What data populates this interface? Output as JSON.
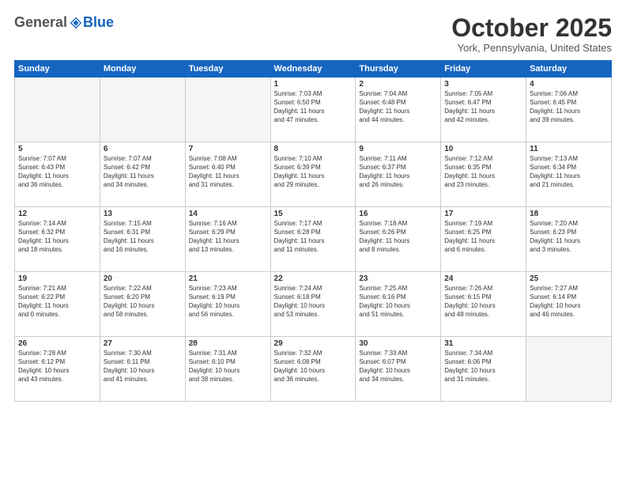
{
  "header": {
    "logo": {
      "general": "General",
      "blue": "Blue"
    },
    "title": "October 2025",
    "location": "York, Pennsylvania, United States"
  },
  "weekdays": [
    "Sunday",
    "Monday",
    "Tuesday",
    "Wednesday",
    "Thursday",
    "Friday",
    "Saturday"
  ],
  "weeks": [
    [
      {
        "day": "",
        "info": ""
      },
      {
        "day": "",
        "info": ""
      },
      {
        "day": "",
        "info": ""
      },
      {
        "day": "1",
        "info": "Sunrise: 7:03 AM\nSunset: 6:50 PM\nDaylight: 11 hours\nand 47 minutes."
      },
      {
        "day": "2",
        "info": "Sunrise: 7:04 AM\nSunset: 6:48 PM\nDaylight: 11 hours\nand 44 minutes."
      },
      {
        "day": "3",
        "info": "Sunrise: 7:05 AM\nSunset: 6:47 PM\nDaylight: 11 hours\nand 42 minutes."
      },
      {
        "day": "4",
        "info": "Sunrise: 7:06 AM\nSunset: 6:45 PM\nDaylight: 11 hours\nand 39 minutes."
      }
    ],
    [
      {
        "day": "5",
        "info": "Sunrise: 7:07 AM\nSunset: 6:43 PM\nDaylight: 11 hours\nand 36 minutes."
      },
      {
        "day": "6",
        "info": "Sunrise: 7:07 AM\nSunset: 6:42 PM\nDaylight: 11 hours\nand 34 minutes."
      },
      {
        "day": "7",
        "info": "Sunrise: 7:08 AM\nSunset: 6:40 PM\nDaylight: 11 hours\nand 31 minutes."
      },
      {
        "day": "8",
        "info": "Sunrise: 7:10 AM\nSunset: 6:39 PM\nDaylight: 11 hours\nand 29 minutes."
      },
      {
        "day": "9",
        "info": "Sunrise: 7:11 AM\nSunset: 6:37 PM\nDaylight: 11 hours\nand 26 minutes."
      },
      {
        "day": "10",
        "info": "Sunrise: 7:12 AM\nSunset: 6:35 PM\nDaylight: 11 hours\nand 23 minutes."
      },
      {
        "day": "11",
        "info": "Sunrise: 7:13 AM\nSunset: 6:34 PM\nDaylight: 11 hours\nand 21 minutes."
      }
    ],
    [
      {
        "day": "12",
        "info": "Sunrise: 7:14 AM\nSunset: 6:32 PM\nDaylight: 11 hours\nand 18 minutes."
      },
      {
        "day": "13",
        "info": "Sunrise: 7:15 AM\nSunset: 6:31 PM\nDaylight: 11 hours\nand 16 minutes."
      },
      {
        "day": "14",
        "info": "Sunrise: 7:16 AM\nSunset: 6:29 PM\nDaylight: 11 hours\nand 13 minutes."
      },
      {
        "day": "15",
        "info": "Sunrise: 7:17 AM\nSunset: 6:28 PM\nDaylight: 11 hours\nand 11 minutes."
      },
      {
        "day": "16",
        "info": "Sunrise: 7:18 AM\nSunset: 6:26 PM\nDaylight: 11 hours\nand 8 minutes."
      },
      {
        "day": "17",
        "info": "Sunrise: 7:19 AM\nSunset: 6:25 PM\nDaylight: 11 hours\nand 6 minutes."
      },
      {
        "day": "18",
        "info": "Sunrise: 7:20 AM\nSunset: 6:23 PM\nDaylight: 11 hours\nand 3 minutes."
      }
    ],
    [
      {
        "day": "19",
        "info": "Sunrise: 7:21 AM\nSunset: 6:22 PM\nDaylight: 11 hours\nand 0 minutes."
      },
      {
        "day": "20",
        "info": "Sunrise: 7:22 AM\nSunset: 6:20 PM\nDaylight: 10 hours\nand 58 minutes."
      },
      {
        "day": "21",
        "info": "Sunrise: 7:23 AM\nSunset: 6:19 PM\nDaylight: 10 hours\nand 56 minutes."
      },
      {
        "day": "22",
        "info": "Sunrise: 7:24 AM\nSunset: 6:18 PM\nDaylight: 10 hours\nand 53 minutes."
      },
      {
        "day": "23",
        "info": "Sunrise: 7:25 AM\nSunset: 6:16 PM\nDaylight: 10 hours\nand 51 minutes."
      },
      {
        "day": "24",
        "info": "Sunrise: 7:26 AM\nSunset: 6:15 PM\nDaylight: 10 hours\nand 48 minutes."
      },
      {
        "day": "25",
        "info": "Sunrise: 7:27 AM\nSunset: 6:14 PM\nDaylight: 10 hours\nand 46 minutes."
      }
    ],
    [
      {
        "day": "26",
        "info": "Sunrise: 7:28 AM\nSunset: 6:12 PM\nDaylight: 10 hours\nand 43 minutes."
      },
      {
        "day": "27",
        "info": "Sunrise: 7:30 AM\nSunset: 6:11 PM\nDaylight: 10 hours\nand 41 minutes."
      },
      {
        "day": "28",
        "info": "Sunrise: 7:31 AM\nSunset: 6:10 PM\nDaylight: 10 hours\nand 38 minutes."
      },
      {
        "day": "29",
        "info": "Sunrise: 7:32 AM\nSunset: 6:08 PM\nDaylight: 10 hours\nand 36 minutes."
      },
      {
        "day": "30",
        "info": "Sunrise: 7:33 AM\nSunset: 6:07 PM\nDaylight: 10 hours\nand 34 minutes."
      },
      {
        "day": "31",
        "info": "Sunrise: 7:34 AM\nSunset: 6:06 PM\nDaylight: 10 hours\nand 31 minutes."
      },
      {
        "day": "",
        "info": ""
      }
    ]
  ]
}
